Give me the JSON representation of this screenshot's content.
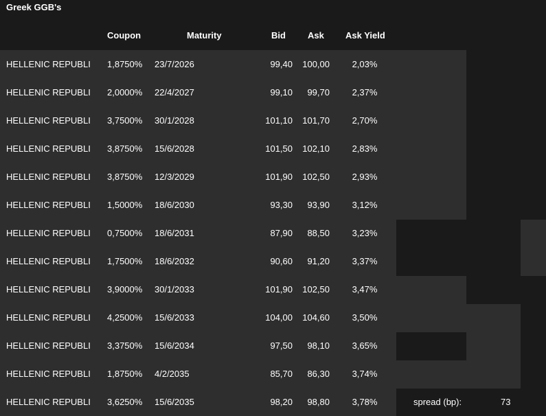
{
  "sheet": {
    "title": "Greek GGB's",
    "columns": {
      "coupon": "Coupon",
      "maturity": "Maturity",
      "bid": "Bid",
      "ask": "Ask",
      "ask_yield": "Ask Yield"
    },
    "rows": [
      {
        "issuer": "HELLENIC REPUBLI",
        "coupon": "1,8750%",
        "maturity": "23/7/2026",
        "bid": "99,40",
        "ask": "100,00",
        "ask_yield": "2,03%"
      },
      {
        "issuer": "HELLENIC REPUBLI",
        "coupon": "2,0000%",
        "maturity": "22/4/2027",
        "bid": "99,10",
        "ask": "99,70",
        "ask_yield": "2,37%"
      },
      {
        "issuer": "HELLENIC REPUBLI",
        "coupon": "3,7500%",
        "maturity": "30/1/2028",
        "bid": "101,10",
        "ask": "101,70",
        "ask_yield": "2,70%"
      },
      {
        "issuer": "HELLENIC REPUBLI",
        "coupon": "3,8750%",
        "maturity": "15/6/2028",
        "bid": "101,50",
        "ask": "102,10",
        "ask_yield": "2,83%"
      },
      {
        "issuer": "HELLENIC REPUBLI",
        "coupon": "3,8750%",
        "maturity": "12/3/2029",
        "bid": "101,90",
        "ask": "102,50",
        "ask_yield": "2,93%"
      },
      {
        "issuer": "HELLENIC REPUBLI",
        "coupon": "1,5000%",
        "maturity": "18/6/2030",
        "bid": "93,30",
        "ask": "93,90",
        "ask_yield": "3,12%"
      },
      {
        "issuer": "HELLENIC REPUBLI",
        "coupon": "0,7500%",
        "maturity": "18/6/2031",
        "bid": "87,90",
        "ask": "88,50",
        "ask_yield": "3,23%"
      },
      {
        "issuer": "HELLENIC REPUBLI",
        "coupon": "1,7500%",
        "maturity": "18/6/2032",
        "bid": "90,60",
        "ask": "91,20",
        "ask_yield": "3,37%"
      },
      {
        "issuer": "HELLENIC REPUBLI",
        "coupon": "3,9000%",
        "maturity": "30/1/2033",
        "bid": "101,90",
        "ask": "102,50",
        "ask_yield": "3,47%"
      },
      {
        "issuer": "HELLENIC REPUBLI",
        "coupon": "4,2500%",
        "maturity": "15/6/2033",
        "bid": "104,00",
        "ask": "104,60",
        "ask_yield": "3,50%"
      },
      {
        "issuer": "HELLENIC REPUBLI",
        "coupon": "3,3750%",
        "maturity": "15/6/2034",
        "bid": "97,50",
        "ask": "98,10",
        "ask_yield": "3,65%"
      },
      {
        "issuer": "HELLENIC REPUBLI",
        "coupon": "1,8750%",
        "maturity": "4/2/2035",
        "bid": "85,70",
        "ask": "86,30",
        "ask_yield": "3,74%"
      },
      {
        "issuer": "HELLENIC REPUBLI",
        "coupon": "3,6250%",
        "maturity": "15/6/2035",
        "bid": "98,20",
        "ask": "98,80",
        "ask_yield": "3,78%"
      }
    ],
    "spread": {
      "label": "spread (bp):",
      "value": "73"
    }
  }
}
